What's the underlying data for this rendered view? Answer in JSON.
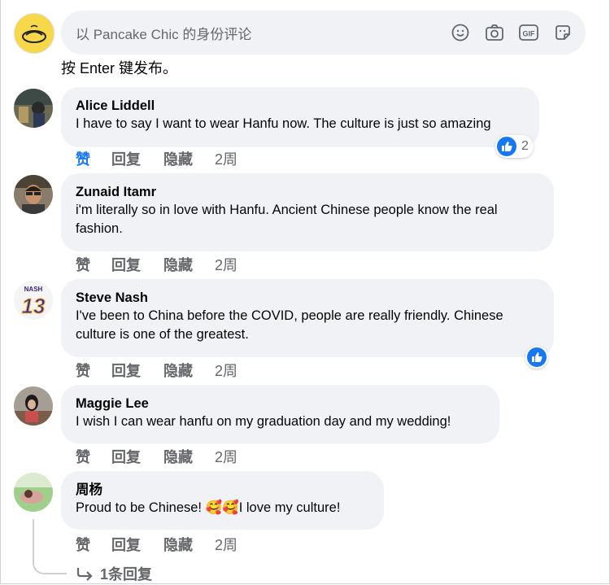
{
  "composer": {
    "placeholder": "以 Pancake Chic 的身份评论",
    "hint": "按 Enter 键发布。",
    "icons": [
      "emoji-icon",
      "camera-icon",
      "gif-icon",
      "sticker-icon"
    ]
  },
  "actions": {
    "like": "赞",
    "reply": "回复",
    "hide": "隐藏"
  },
  "comments": [
    {
      "author": "Alice Liddell",
      "lines": [
        "I have to say I want to wear Hanfu now. The culture is just so amazing"
      ],
      "time": "2周",
      "liked": true,
      "reaction_count": "2"
    },
    {
      "author": "Zunaid Itamr",
      "lines": [
        "i'm literally so in love with Hanfu. Ancient Chinese people know the real",
        "fashion."
      ],
      "time": "2周"
    },
    {
      "author": "Steve Nash",
      "lines": [
        "I've been to China before the COVID, people are really friendly. Chinese",
        "culture is one of the greatest."
      ],
      "time": "2周",
      "avatar_text": "NASH",
      "avatar_number": "13"
    },
    {
      "author": "Maggie Lee",
      "lines": [
        "I wish I can wear hanfu on my graduation day and my wedding!"
      ],
      "time": "2周"
    },
    {
      "author": "周杨",
      "text_before": "Proud to be Chinese! ",
      "emojis": "🥰🥰",
      "text_after": "I love my culture!",
      "time": "2周"
    }
  ],
  "replies_link": "1条回复",
  "colors": {
    "accent": "#1877f2",
    "bubble": "#f0f2f5",
    "muted": "#65676b"
  }
}
